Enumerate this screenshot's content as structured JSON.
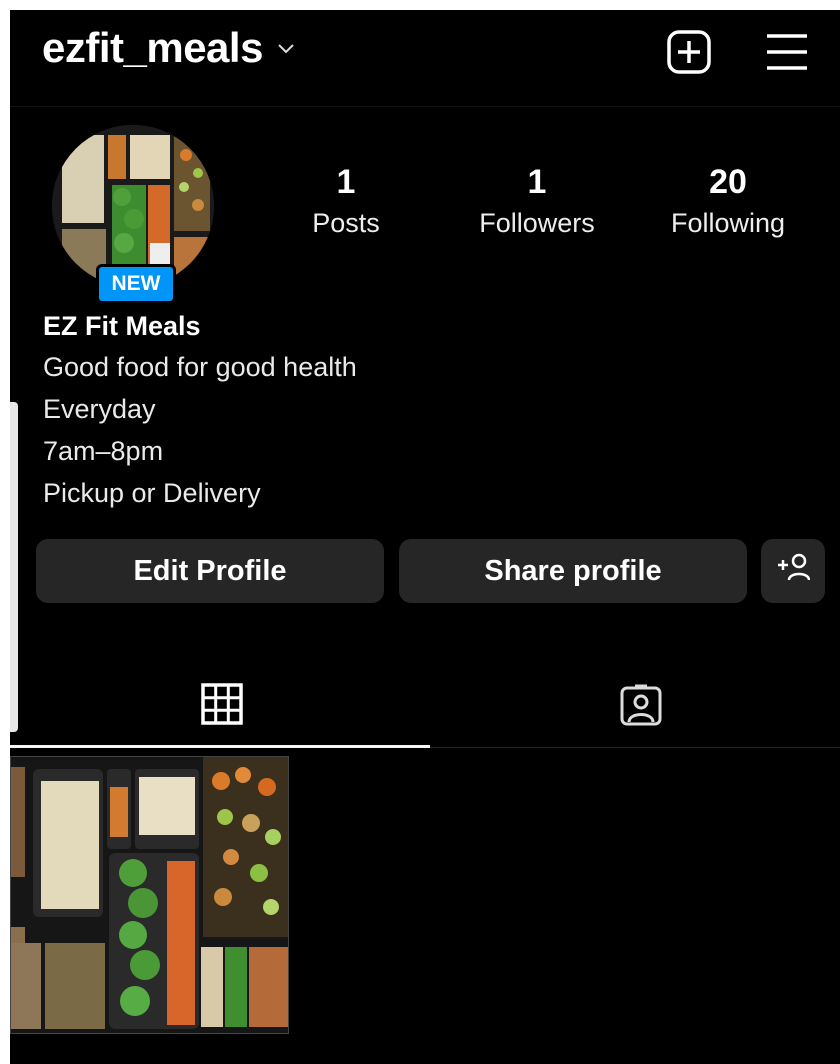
{
  "header": {
    "username": "ezfit_meals"
  },
  "profile": {
    "badge": "NEW",
    "stats": [
      {
        "value": "1",
        "label": "Posts"
      },
      {
        "value": "1",
        "label": "Followers"
      },
      {
        "value": "20",
        "label": "Following"
      }
    ],
    "display_name": "EZ Fit Meals",
    "bio_lines": [
      "Good food for good health",
      "Everyday",
      "7am–8pm",
      "Pickup or Delivery"
    ]
  },
  "actions": {
    "edit_label": "Edit Profile",
    "share_label": "Share profile"
  },
  "icons": {
    "chevron": "chevron-down-icon",
    "add": "add-square-icon",
    "menu": "hamburger-menu-icon",
    "discover": "add-person-icon",
    "grid": "grid-icon",
    "tagged": "tagged-person-icon"
  },
  "colors": {
    "background": "#000000",
    "button": "#262626",
    "badge": "#0095f6"
  }
}
